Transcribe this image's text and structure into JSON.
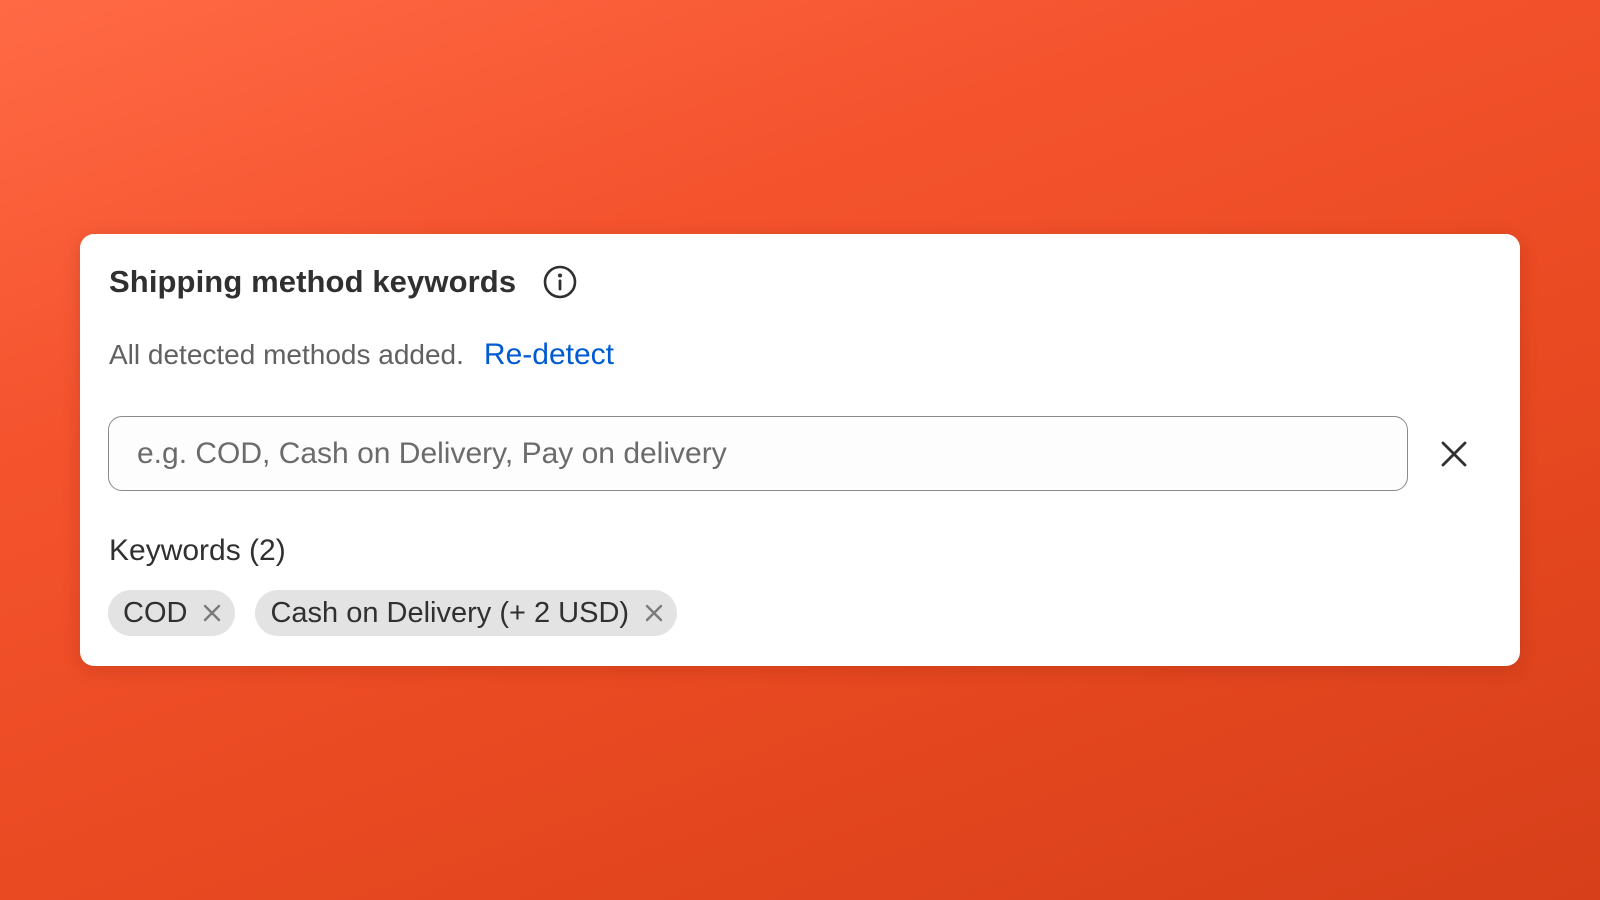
{
  "card": {
    "title": "Shipping method keywords",
    "info_icon": "info-circle-icon",
    "status_text": "All detected methods added.",
    "redetect_label": "Re-detect"
  },
  "search": {
    "value": "",
    "placeholder": "e.g. COD, Cash on Delivery, Pay on delivery",
    "clear_icon": "close-icon"
  },
  "keywords": {
    "heading": "Keywords (2)",
    "items": [
      {
        "label": "COD",
        "remove_icon": "close-icon"
      },
      {
        "label": "Cash on Delivery (+ 2 USD)",
        "remove_icon": "close-icon"
      }
    ]
  },
  "colors": {
    "background_gradient_start": "#ff6a45",
    "background_gradient_end": "#d63f1a",
    "card": "#ffffff",
    "link": "#005bd3",
    "tag_background": "#e3e3e3",
    "text_primary": "#303030",
    "text_secondary": "#616161"
  }
}
